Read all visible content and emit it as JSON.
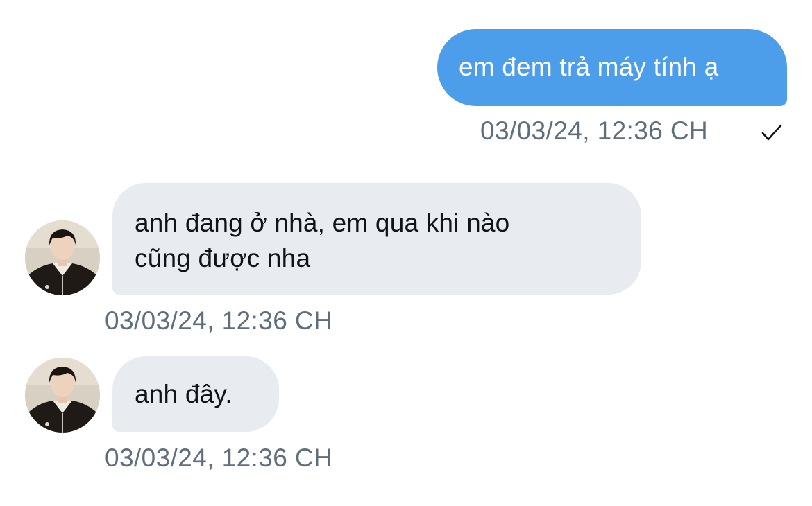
{
  "conversation": {
    "messages": [
      {
        "direction": "sent",
        "lines": [
          "em đem trả máy tính ạ"
        ],
        "timestamp": "03/03/24, 12:36 CH",
        "status_icon": "check-icon"
      },
      {
        "direction": "received",
        "lines": [
          "anh đang ở nhà, em qua khi nào",
          "cũng được nha"
        ],
        "timestamp": "03/03/24, 12:36 CH",
        "avatar_icon": "contact-avatar"
      },
      {
        "direction": "received",
        "lines": [
          "anh đây."
        ],
        "timestamp": "03/03/24, 12:36 CH",
        "avatar_icon": "contact-avatar"
      }
    ]
  },
  "colors": {
    "sent_bubble": "#4c9eea",
    "received_bubble": "#e8ebef",
    "timestamp_text": "#5f6e7d",
    "background": "#ffffff"
  }
}
